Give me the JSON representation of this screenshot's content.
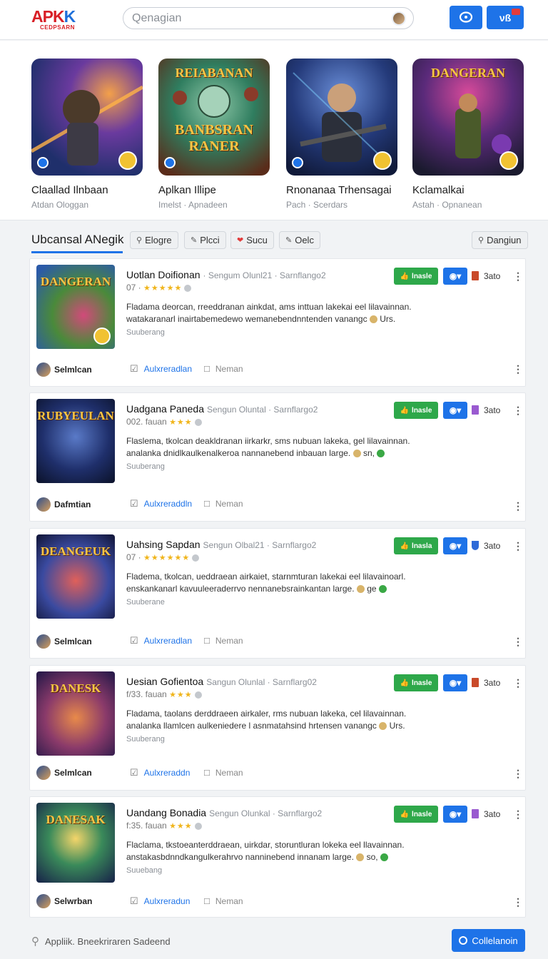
{
  "header": {
    "logo_main": "APK",
    "logo_accent": "K",
    "logo_tag": "CEDPSARN",
    "search_placeholder": "Qenagian",
    "btn1_icon": "chat-icon",
    "btn2_label": "νß"
  },
  "featured": [
    {
      "title": "Claallad Ilnbaan",
      "sub": "Atdan Ologgan",
      "overlay": ""
    },
    {
      "title": "Aplkan Illipe",
      "sub": "Imelst · Apnadeen",
      "overlay_top": "REIABANAN",
      "overlay": "BANBSRAN RANER"
    },
    {
      "title": "Rnonanaa Trhensagai",
      "sub": "Pach · Scerdars",
      "overlay": ""
    },
    {
      "title": "Kclamalkai",
      "sub": "Astah · Opnanean",
      "overlay_top": "DANGERAN"
    }
  ],
  "tabs": {
    "active": "Ubcansal ANegik",
    "chips": [
      "Elogre",
      "Plcci",
      "Sucu",
      "Oelc"
    ],
    "right_chip": "Dangiun"
  },
  "cards": [
    {
      "title": "Uotlan Doifionan",
      "meta": "· Sengum Olunl21 · Sarnflango2",
      "rating_prefix": "07 ·",
      "stars": "★★★★★",
      "desc1": "Fladama deorcan, rreeddranan ainkdat, ams inttuan lakekai eel lilavainnan.",
      "desc2": "watakaranarl inairtabemedewo wemanebendnntenden vanangc",
      "desc2_tail": "Urs.",
      "category": "Suuberang",
      "thumb_title": "DANGERAN",
      "green": "lnasle",
      "stato": "3ato",
      "author": "Selmlcan",
      "action1": "Aulxreradlan",
      "action2": "Neman"
    },
    {
      "title": "Uadgana Paneda",
      "meta": "Sengun Oluntal · Sarnflargo2",
      "rating_prefix": "002. fauan",
      "stars": "★★★",
      "desc1": "Flaslema, tkolcan deakldranan iirkarkr, sms nubuan lakeka, gel lilavainnan.",
      "desc2": "analanka dnidlkaulkenalkeroa nannanebend inbauan large.",
      "desc2_tail": "sn,",
      "category": "Suuberang",
      "thumb_title": "RUBYEULAN",
      "green": "lnasle",
      "stato": "3ato",
      "author": "Dafmtian",
      "action1": "Aulxreraddln",
      "action2": "Neman"
    },
    {
      "title": "Uahsing Sapdan",
      "meta": "Sengun Olbal21 · Sarnflargo2",
      "rating_prefix": "07 ·",
      "stars": "★★★★★★",
      "desc1": "Fladema, tkolcan, ueddraean airkaiet, starnmturan lakekai eel lilavainoarl.",
      "desc2": "enskankanarl kavuuleeraderrvo nennanebsrainkantan large.",
      "desc2_tail": "ge",
      "category": "Suuberane",
      "thumb_title": "DEANGEUK",
      "green": "lnasla",
      "stato": "3ato",
      "author": "Selmlcan",
      "action1": "Aulxreradlan",
      "action2": "Neman"
    },
    {
      "title": "Uesian Gofientoa",
      "meta": "Sangun Olunlal · Sarnflarg02",
      "rating_prefix": "f/33. fauan",
      "stars": "★★★",
      "desc1": "Fladama, taolans derddraeen airkaler, rms nubuan lakeka, cel lilavainnan.",
      "desc2": "analanka llamlcen aulkeniedere l asnmatahsind hrtensen vanangc",
      "desc2_tail": "Urs.",
      "category": "Suuberang",
      "thumb_title": "DANESK",
      "green": "lnasle",
      "stato": "3ato",
      "author": "Selmlcan",
      "action1": "Aulxreraddn",
      "action2": "Neman"
    },
    {
      "title": "Uandang Bonadia",
      "meta": "Sengun Olunkal · Sarnflargo2",
      "rating_prefix": "f:35. fauan",
      "stars": "★★★",
      "desc1": "Flaclama, tkstoeanterddraean, uirkdar, storuntluran lokeka eel llavainnan.",
      "desc2": "anstakasbdnndkangulkerahrvo nanninebend innanam large.",
      "desc2_tail": "so,",
      "category": "Suuebang",
      "thumb_title": "DANESAK",
      "green": "lnasle",
      "stato": "3ato",
      "author": "Selwrban",
      "action1": "Aulxreradun",
      "action2": "Neman"
    }
  ],
  "footer": {
    "search_text": "Appliik. Bneekriraren Sadeend",
    "button_label": "Collelanoin"
  }
}
